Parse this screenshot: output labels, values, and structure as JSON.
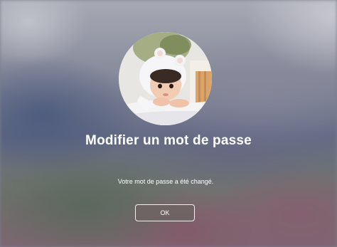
{
  "dialog": {
    "title": "Modifier un mot de passe",
    "message": "Votre mot de passe a été changé.",
    "ok_label": "OK"
  },
  "avatar": {
    "icon": "user-avatar-photo"
  },
  "colors": {
    "text": "#ffffff",
    "button_bg": "#6e6464",
    "button_border": "#ffffff"
  }
}
